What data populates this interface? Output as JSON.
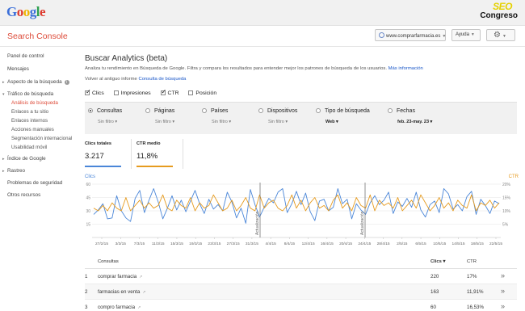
{
  "header": {
    "google_letters": [
      {
        "ch": "G",
        "color": "#3b6fd9"
      },
      {
        "ch": "o",
        "color": "#dd3a2e"
      },
      {
        "ch": "o",
        "color": "#f0b400"
      },
      {
        "ch": "g",
        "color": "#3b6fd9"
      },
      {
        "ch": "l",
        "color": "#2ea04f"
      },
      {
        "ch": "e",
        "color": "#dd3a2e"
      }
    ],
    "seo": "SEO",
    "congreso": "Congreso",
    "product": "Search Console",
    "site": "www.comprarfarmacia.es",
    "help": "Ayuda",
    "gear_icon": "gear-icon"
  },
  "sidebar": {
    "items": [
      {
        "label": "Panel de control"
      },
      {
        "label": "Mensajes"
      },
      {
        "label": "Aspecto de la búsqueda"
      },
      {
        "label": "Tráfico de búsqueda"
      },
      {
        "label": "Índice de Google"
      },
      {
        "label": "Rastreo"
      },
      {
        "label": "Problemas de seguridad"
      },
      {
        "label": "Otros recursos"
      }
    ],
    "subitems": [
      {
        "label": "Análisis de búsqueda"
      },
      {
        "label": "Enlaces a tu sitio"
      },
      {
        "label": "Enlaces internos"
      },
      {
        "label": "Acciones manuales"
      },
      {
        "label": "Segmentación internacional"
      },
      {
        "label": "Usabilidad móvil"
      }
    ]
  },
  "main": {
    "title": "Buscar Analytics (beta)",
    "description": "Analiza tu rendimiento en Búsqueda de Google. Filtra y compara los resultados para entender mejor los patrones de búsqueda de los usuarios.",
    "more_info": "Más información",
    "old_report_prefix": "Volver al antiguo informe",
    "old_report_link": "Consulta de búsqueda",
    "metrics": [
      {
        "label": "Clics",
        "checked": true
      },
      {
        "label": "Impresiones",
        "checked": false
      },
      {
        "label": "CTR",
        "checked": true
      },
      {
        "label": "Posición",
        "checked": false
      }
    ],
    "filters": [
      {
        "label": "Consultas",
        "sub": "Sin filtro ▾",
        "selected": true
      },
      {
        "label": "Páginas",
        "sub": "Sin filtro ▾",
        "selected": false
      },
      {
        "label": "Países",
        "sub": "Sin filtro ▾",
        "selected": false
      },
      {
        "label": "Dispositivos",
        "sub": "Sin filtro ▾",
        "selected": false
      },
      {
        "label": "Tipo de búsqueda",
        "sub": "Web ▾",
        "selected": false
      },
      {
        "label": "Fechas",
        "sub": "feb. 23-may. 23 ▾",
        "selected": false
      }
    ],
    "cards": [
      {
        "title": "Clics totales",
        "value": "3.217",
        "color": "#4a86d8"
      },
      {
        "title": "CTR medio",
        "value": "11,8%",
        "color": "#e69b1f"
      }
    ],
    "table": {
      "headers": {
        "num": "",
        "query": "Consultas",
        "clicks": "Clics ▾",
        "ctr": "CTR"
      },
      "rows": [
        {
          "num": "1",
          "query": "comprar farmacia",
          "clicks": "220",
          "ctr": "17%"
        },
        {
          "num": "2",
          "query": "farmacias en venta",
          "clicks": "163",
          "ctr": "11,91%"
        },
        {
          "num": "3",
          "query": "compro farmacia",
          "clicks": "60",
          "ctr": "16,53%"
        }
      ]
    }
  },
  "chart_data": {
    "type": "line",
    "left_axis_title": "Clics",
    "right_axis_title": "CTR",
    "left_ticks": [
      "60",
      "45",
      "30",
      "15"
    ],
    "right_ticks": [
      "20%",
      "15%",
      "10%",
      "5%"
    ],
    "ylim_left": [
      0,
      60
    ],
    "ylim_right": [
      0,
      20
    ],
    "x_ticks": [
      "27/2/15",
      "3/3/15",
      "7/3/15",
      "11/3/15",
      "15/3/15",
      "19/3/15",
      "23/3/15",
      "27/3/15",
      "31/3/15",
      "4/4/15",
      "8/4/15",
      "12/4/15",
      "16/4/15",
      "20/4/15",
      "24/4/15",
      "28/4/15",
      "2/5/15",
      "6/5/15",
      "10/5/15",
      "14/5/15",
      "18/5/15",
      "22/5/15"
    ],
    "annotations": [
      {
        "label": "Actualización",
        "x": "1/4/15"
      },
      {
        "label": "Actualización",
        "x": "25/4/15"
      }
    ],
    "series": [
      {
        "name": "Clics",
        "color": "#4a86d8",
        "values": [
          26,
          31,
          38,
          21,
          22,
          47,
          30,
          22,
          18,
          44,
          53,
          28,
          42,
          55,
          40,
          21,
          33,
          47,
          31,
          42,
          29,
          41,
          53,
          38,
          27,
          43,
          32,
          37,
          30,
          51,
          40,
          22,
          33,
          16,
          54,
          37,
          23,
          34,
          44,
          39,
          51,
          55,
          28,
          38,
          52,
          37,
          50,
          29,
          19,
          41,
          43,
          30,
          34,
          55,
          38,
          43,
          21,
          38,
          31,
          26,
          39,
          47,
          37,
          42,
          51,
          27,
          40,
          35,
          44,
          34,
          51,
          31,
          23,
          37,
          41,
          28,
          55,
          49,
          32,
          37,
          30,
          46,
          52,
          26,
          43,
          36,
          27,
          41,
          38
        ]
      },
      {
        "name": "CTR",
        "color": "#e69b1f",
        "values": [
          11,
          10,
          12,
          10,
          13,
          11,
          10,
          15,
          10,
          12,
          14,
          11,
          13,
          11,
          12,
          16,
          11,
          10,
          14,
          12,
          11,
          15,
          10,
          13,
          11,
          12,
          16,
          13,
          10,
          11,
          14,
          10,
          12,
          15,
          11,
          10,
          16,
          11,
          13,
          14,
          11,
          10,
          12,
          16,
          11,
          14,
          10,
          13,
          15,
          11,
          12,
          10,
          14,
          16,
          11,
          13,
          10,
          15,
          12,
          11,
          16,
          10,
          14,
          12,
          13,
          11,
          15,
          10,
          12,
          14,
          11,
          16,
          13,
          10,
          12,
          15,
          11,
          13,
          10,
          14,
          12,
          11,
          16,
          10,
          13,
          12,
          14,
          11,
          13
        ]
      }
    ]
  }
}
